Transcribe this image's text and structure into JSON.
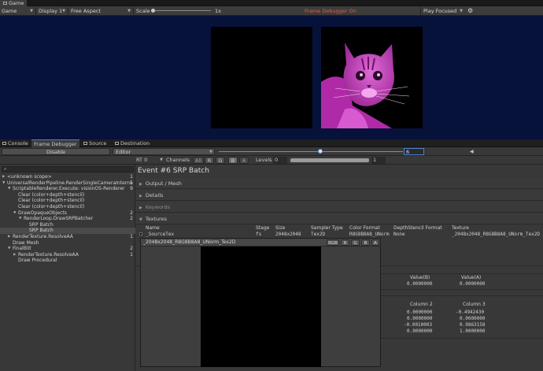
{
  "window": {
    "tab_label": "Game"
  },
  "game_toolbar": {
    "mode": "Game",
    "display": "Display 1",
    "aspect": "Free Aspect",
    "scale_label": "Scale",
    "scale_value": "1x",
    "status": "Frame Debugger On",
    "play_mode": "Play Focused",
    "colors": {
      "status": "#e05a4a"
    }
  },
  "game_view": {
    "background": "#06123a",
    "images": [
      "black-square",
      "cat-photo-magenta"
    ]
  },
  "panel_tabs": [
    "Console",
    "Frame Debugger",
    "Source",
    "Destination"
  ],
  "frame_debugger": {
    "disable_label": "Disable",
    "target": "Editor",
    "frame_value": "6",
    "rt_label": "RT 0",
    "channels_label": "Channels",
    "channel_buttons": [
      "All",
      "R",
      "G",
      "B",
      "A"
    ],
    "levels_label": "Levels",
    "levels_min": "0",
    "levels_max": "1"
  },
  "tree": [
    {
      "label": "<unknown scope>",
      "count": "1",
      "indent": 0,
      "arrow": "▶"
    },
    {
      "label": "UniversalRenderPipeline.RenderSingleCameraInterna",
      "count": "5",
      "indent": 0,
      "arrow": "▼"
    },
    {
      "label": "ScriptableRenderer.Execute: visionOS-Renderer",
      "count": "9",
      "indent": 1,
      "arrow": "▼"
    },
    {
      "label": "Clear (color+depth+stencil)",
      "count": "",
      "indent": 2,
      "arrow": ""
    },
    {
      "label": "Clear (color+depth+stencil)",
      "count": "",
      "indent": 2,
      "arrow": ""
    },
    {
      "label": "Clear (color+depth+stencil)",
      "count": "",
      "indent": 2,
      "arrow": ""
    },
    {
      "label": "DrawOpaqueObjects",
      "count": "2",
      "indent": 2,
      "arrow": "▼"
    },
    {
      "label": "RenderLoop.DrawSRPBatcher",
      "count": "2",
      "indent": 3,
      "arrow": "▼"
    },
    {
      "label": "SRP Batch",
      "count": "",
      "indent": 4,
      "arrow": ""
    },
    {
      "label": "SRP Batch",
      "count": "",
      "indent": 4,
      "arrow": "",
      "selected": true
    },
    {
      "label": "RenderTexture.ResolveAA",
      "count": "1",
      "indent": 1,
      "arrow": "▶"
    },
    {
      "label": "Draw Mesh",
      "count": "",
      "indent": 1,
      "arrow": ""
    },
    {
      "label": "FinalBlit",
      "count": "2",
      "indent": 1,
      "arrow": "▼"
    },
    {
      "label": "RenderTexture.ResolveAA",
      "count": "1",
      "indent": 2,
      "arrow": "▶"
    },
    {
      "label": "Draw Procedural",
      "count": "",
      "indent": 2,
      "arrow": ""
    }
  ],
  "event": {
    "title": "Event #6 SRP Batch",
    "sections": [
      "Output / Mesh",
      "Details",
      "Keywords",
      "Textures"
    ]
  },
  "textures": {
    "headers": [
      "Name",
      "Stage",
      "Size",
      "Sampler Type",
      "Color Format",
      "DepthStencil Format",
      "Texture"
    ],
    "row": [
      "_SourceTex",
      "fs",
      "2048x2048",
      "Tex2D",
      "R8G8B8A8_UNorm",
      "None",
      "_2048x2048_R8G8B8A8_UNorm_Tex2D"
    ]
  },
  "preview_popup": {
    "title": "_2048x2048_R8G8B8A8_UNorm_Tex2D",
    "buttons": [
      "RGB",
      "R",
      "G",
      "B",
      "A"
    ]
  },
  "values_table": {
    "headers": [
      "Value(B)",
      "Value(A)"
    ],
    "row": [
      "0.0000000",
      "0.0000000"
    ]
  },
  "matrix_table": {
    "headers": [
      "Column 2",
      "Column 3"
    ],
    "rows": [
      [
        "0.0000000",
        "-0.4942430"
      ],
      [
        "0.0000000",
        "0.0000000"
      ],
      [
        "-0.0010003",
        "0.9863158"
      ],
      [
        "0.0000000",
        "1.0000000"
      ]
    ]
  }
}
